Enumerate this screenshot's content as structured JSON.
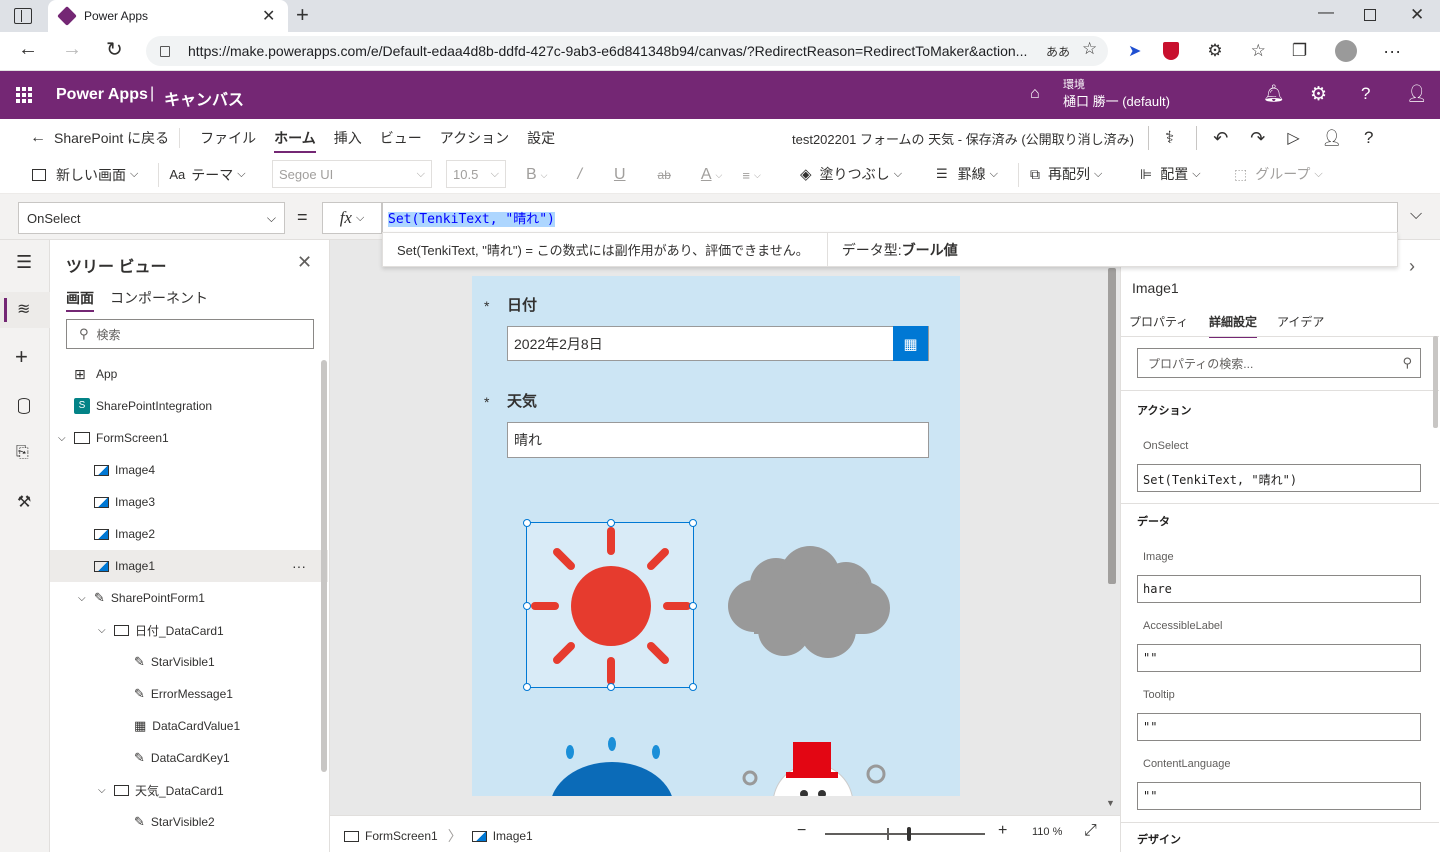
{
  "browser": {
    "tab_title": "Power Apps",
    "url": "https://make.powerapps.com/e/Default-edaa4d8b-ddfd-427c-9ab3-e6d841348b94/canvas/?RedirectReason=RedirectToMaker&action...",
    "reader_label": "ああ"
  },
  "app_header": {
    "title": "Power Apps",
    "separator": "|",
    "subtitle": "キャンバス",
    "env_label": "環境",
    "env_name": "樋口 勝一 (default)"
  },
  "menubar": {
    "back_label": "SharePoint に戻る",
    "items": [
      "ファイル",
      "ホーム",
      "挿入",
      "ビュー",
      "アクション",
      "設定"
    ],
    "doc_title": "test202201 フォームの 天気 - 保存済み (公開取り消し済み)"
  },
  "ribbon": {
    "new_screen": "新しい画面",
    "theme": "テーマ",
    "font": "Segoe UI",
    "font_size": "10.5",
    "bold": "B",
    "italic": "/",
    "underline": "U",
    "strike": "ab",
    "font_color": "A",
    "fill": "塗りつぶし",
    "border": "罫線",
    "reorder": "再配列",
    "align": "配置",
    "group": "グループ"
  },
  "formula": {
    "property": "OnSelect",
    "equals": "=",
    "fx": "fx",
    "expression": "Set(TenkiText, \"晴れ\")",
    "hint_expr": "Set(TenkiText, \"晴れ\")  =  この数式には副作用があり、評価できません。",
    "hint_type_label": "データ型: ",
    "hint_type_value": "ブール値"
  },
  "tree": {
    "title": "ツリー ビュー",
    "tab_screens": "画面",
    "tab_components": "コンポーネント",
    "search_placeholder": "検索",
    "items": [
      {
        "label": "App"
      },
      {
        "label": "SharePointIntegration"
      },
      {
        "label": "FormScreen1"
      },
      {
        "label": "Image4"
      },
      {
        "label": "Image3"
      },
      {
        "label": "Image2"
      },
      {
        "label": "Image1"
      },
      {
        "label": "SharePointForm1"
      },
      {
        "label": "日付_DataCard1"
      },
      {
        "label": "StarVisible1"
      },
      {
        "label": "ErrorMessage1"
      },
      {
        "label": "DataCardValue1"
      },
      {
        "label": "DataCardKey1"
      },
      {
        "label": "天気_DataCard1"
      },
      {
        "label": "StarVisible2"
      }
    ],
    "more": "···"
  },
  "form": {
    "date_star": "*",
    "date_label": "日付",
    "date_value": "2022年2月8日",
    "weather_star": "*",
    "weather_label": "天気",
    "weather_value": "晴れ"
  },
  "statusbar": {
    "screen": "FormScreen1",
    "control": "Image1",
    "minus": "−",
    "plus": "+",
    "zoom": "110 %"
  },
  "rpanel": {
    "control_name": "Image1",
    "tabs": [
      "プロパティ",
      "詳細設定",
      "アイデア"
    ],
    "search_placeholder": "プロパティの検索...",
    "section_action": "アクション",
    "onselect_label": "OnSelect",
    "onselect_value": "Set(TenkiText, \"晴れ\")",
    "section_data": "データ",
    "image_label": "Image",
    "image_value": "hare",
    "accessible_label": "AccessibleLabel",
    "accessible_value": "\"\"",
    "tooltip_label": "Tooltip",
    "tooltip_value": "\"\"",
    "contentlang_label": "ContentLanguage",
    "contentlang_value": "\"\"",
    "section_design": "デザイン"
  },
  "colors": {
    "brand": "#742774",
    "accent": "#0078d4",
    "canvas_bg": "#cce5f4",
    "sun": "#e63b2e",
    "cloud": "#999999"
  }
}
